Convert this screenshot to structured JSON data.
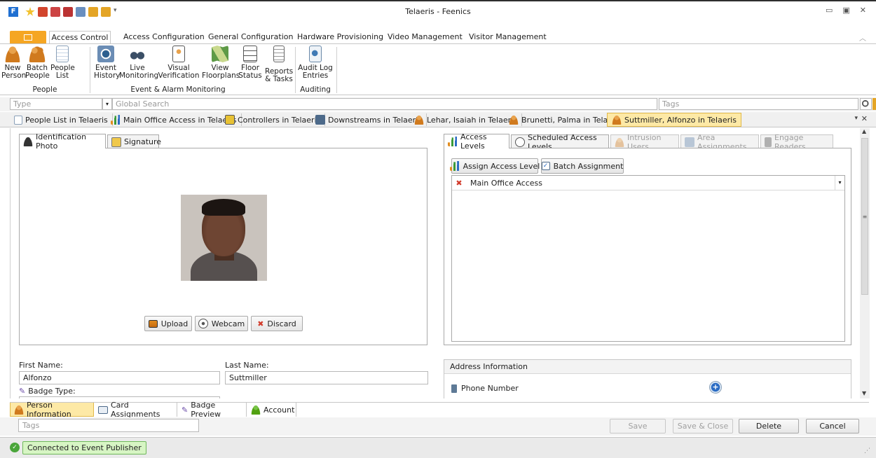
{
  "window": {
    "title": "Telaeris - Feenics"
  },
  "ribbon": {
    "tabs": [
      "Access Control",
      "Access Configuration",
      "General Configuration",
      "Hardware Provisioning",
      "Video Management",
      "Visitor Management"
    ],
    "groups": {
      "people": "People",
      "event": "Event & Alarm Monitoring",
      "auditing": "Auditing"
    },
    "buttons": {
      "new_person": [
        "New",
        "Person"
      ],
      "batch_people": [
        "Batch",
        "People"
      ],
      "people_list": [
        "People",
        "List"
      ],
      "event_history": [
        "Event",
        "History"
      ],
      "live_monitoring": [
        "Live",
        "Monitoring"
      ],
      "visual_verification": [
        "Visual",
        "Verification"
      ],
      "view_floorplans": [
        "View",
        "Floorplans"
      ],
      "floor_status": [
        "Floor",
        "Status"
      ],
      "reports_tasks": [
        "Reports",
        "& Tasks"
      ],
      "audit_log": [
        "Audit Log",
        "Entries"
      ]
    }
  },
  "search": {
    "type_placeholder": "Type",
    "global_placeholder": "Global Search",
    "tags_placeholder": "Tags"
  },
  "doc_tabs": [
    "People List in Telaeris",
    "Main Office Access in Telaeris",
    "Controllers in Telaeris",
    "Downstreams in Telaeris",
    "Lehar, Isaiah in Telaeris",
    "Brunetti, Palma in Telaeris",
    "Suttmiller, Alfonzo in Telaeris"
  ],
  "photo_panel": {
    "tabs": [
      "Identification Photo",
      "Signature"
    ],
    "buttons": {
      "upload": "Upload",
      "webcam": "Webcam",
      "discard": "Discard"
    }
  },
  "access_panel": {
    "tabs": [
      "Access Levels",
      "Scheduled Access Levels",
      "Intrusion Users",
      "Area Assignments",
      "Engage Readers"
    ],
    "buttons": {
      "assign": "Assign Access Level",
      "batch": "Batch Assignment"
    },
    "levels": [
      "Main Office Access"
    ]
  },
  "person_form": {
    "first_name_label": "First Name:",
    "first_name": "Alfonzo",
    "last_name_label": "Last Name:",
    "last_name": "Suttmiller",
    "badge_type_label": "Badge Type:"
  },
  "address": {
    "title": "Address Information",
    "phone_label": "Phone Number"
  },
  "bottom_tabs": [
    "Person Information",
    "Card Assignments",
    "Badge Preview",
    "Account"
  ],
  "footer": {
    "tags_placeholder": "Tags",
    "save": "Save",
    "save_close": "Save & Close",
    "delete": "Delete",
    "cancel": "Cancel"
  },
  "status": {
    "text": "Connected to Event Publisher"
  },
  "colors": {
    "accent_orange": "#f5a623",
    "active_tab": "#fde9a6",
    "status_green": "#d7f5c4"
  }
}
